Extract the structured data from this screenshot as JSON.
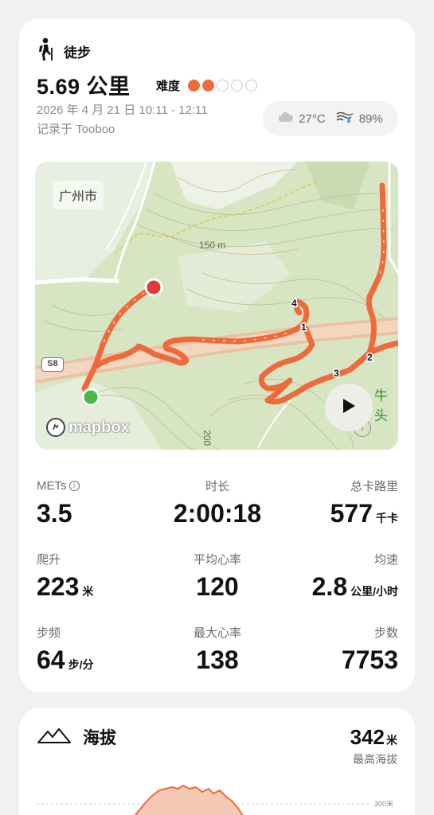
{
  "activity": {
    "type_label": "徒步",
    "icon": "hiking-icon"
  },
  "summary": {
    "distance": "5.69 公里",
    "difficulty_label": "难度",
    "difficulty_level": 2,
    "difficulty_max": 5,
    "time_range": "2026 年 4 月 21 日  10:11 - 12:11",
    "source": "记录于 Tooboo"
  },
  "weather": {
    "temperature": "27°C",
    "humidity": "89%",
    "icons": [
      "cloud-icon",
      "humidity-icon"
    ]
  },
  "map": {
    "city_label": "广州市",
    "contour_label_150": "150 m",
    "contour_label_200": "200",
    "road_badge": "S8",
    "place_label": "牛头",
    "attribution": "mapbox",
    "route_markers": [
      "1",
      "2",
      "3",
      "4"
    ],
    "colors": {
      "route": "#ee6a3a",
      "start": "#4cb84b",
      "end": "#e23a3a",
      "terrain": "#d6e4c2"
    }
  },
  "stats": [
    [
      {
        "label": "METs",
        "value": "3.5",
        "unit": "",
        "info": true
      },
      {
        "label": "时长",
        "value": "2:00:18",
        "unit": ""
      },
      {
        "label": "总卡路里",
        "value": "577",
        "unit": "千卡"
      }
    ],
    [
      {
        "label": "爬升",
        "value": "223",
        "unit": "米"
      },
      {
        "label": "平均心率",
        "value": "120",
        "unit": ""
      },
      {
        "label": "均速",
        "value": "2.8",
        "unit": "公里/小时"
      }
    ],
    [
      {
        "label": "步频",
        "value": "64",
        "unit": "步/分"
      },
      {
        "label": "最大心率",
        "value": "138",
        "unit": ""
      },
      {
        "label": "步数",
        "value": "7753",
        "unit": ""
      }
    ]
  ],
  "elevation": {
    "title": "海拔",
    "max_value": "342",
    "max_unit": "米",
    "max_label": "最高海拔",
    "tick_label": "300米",
    "icon": "mountain-icon"
  }
}
